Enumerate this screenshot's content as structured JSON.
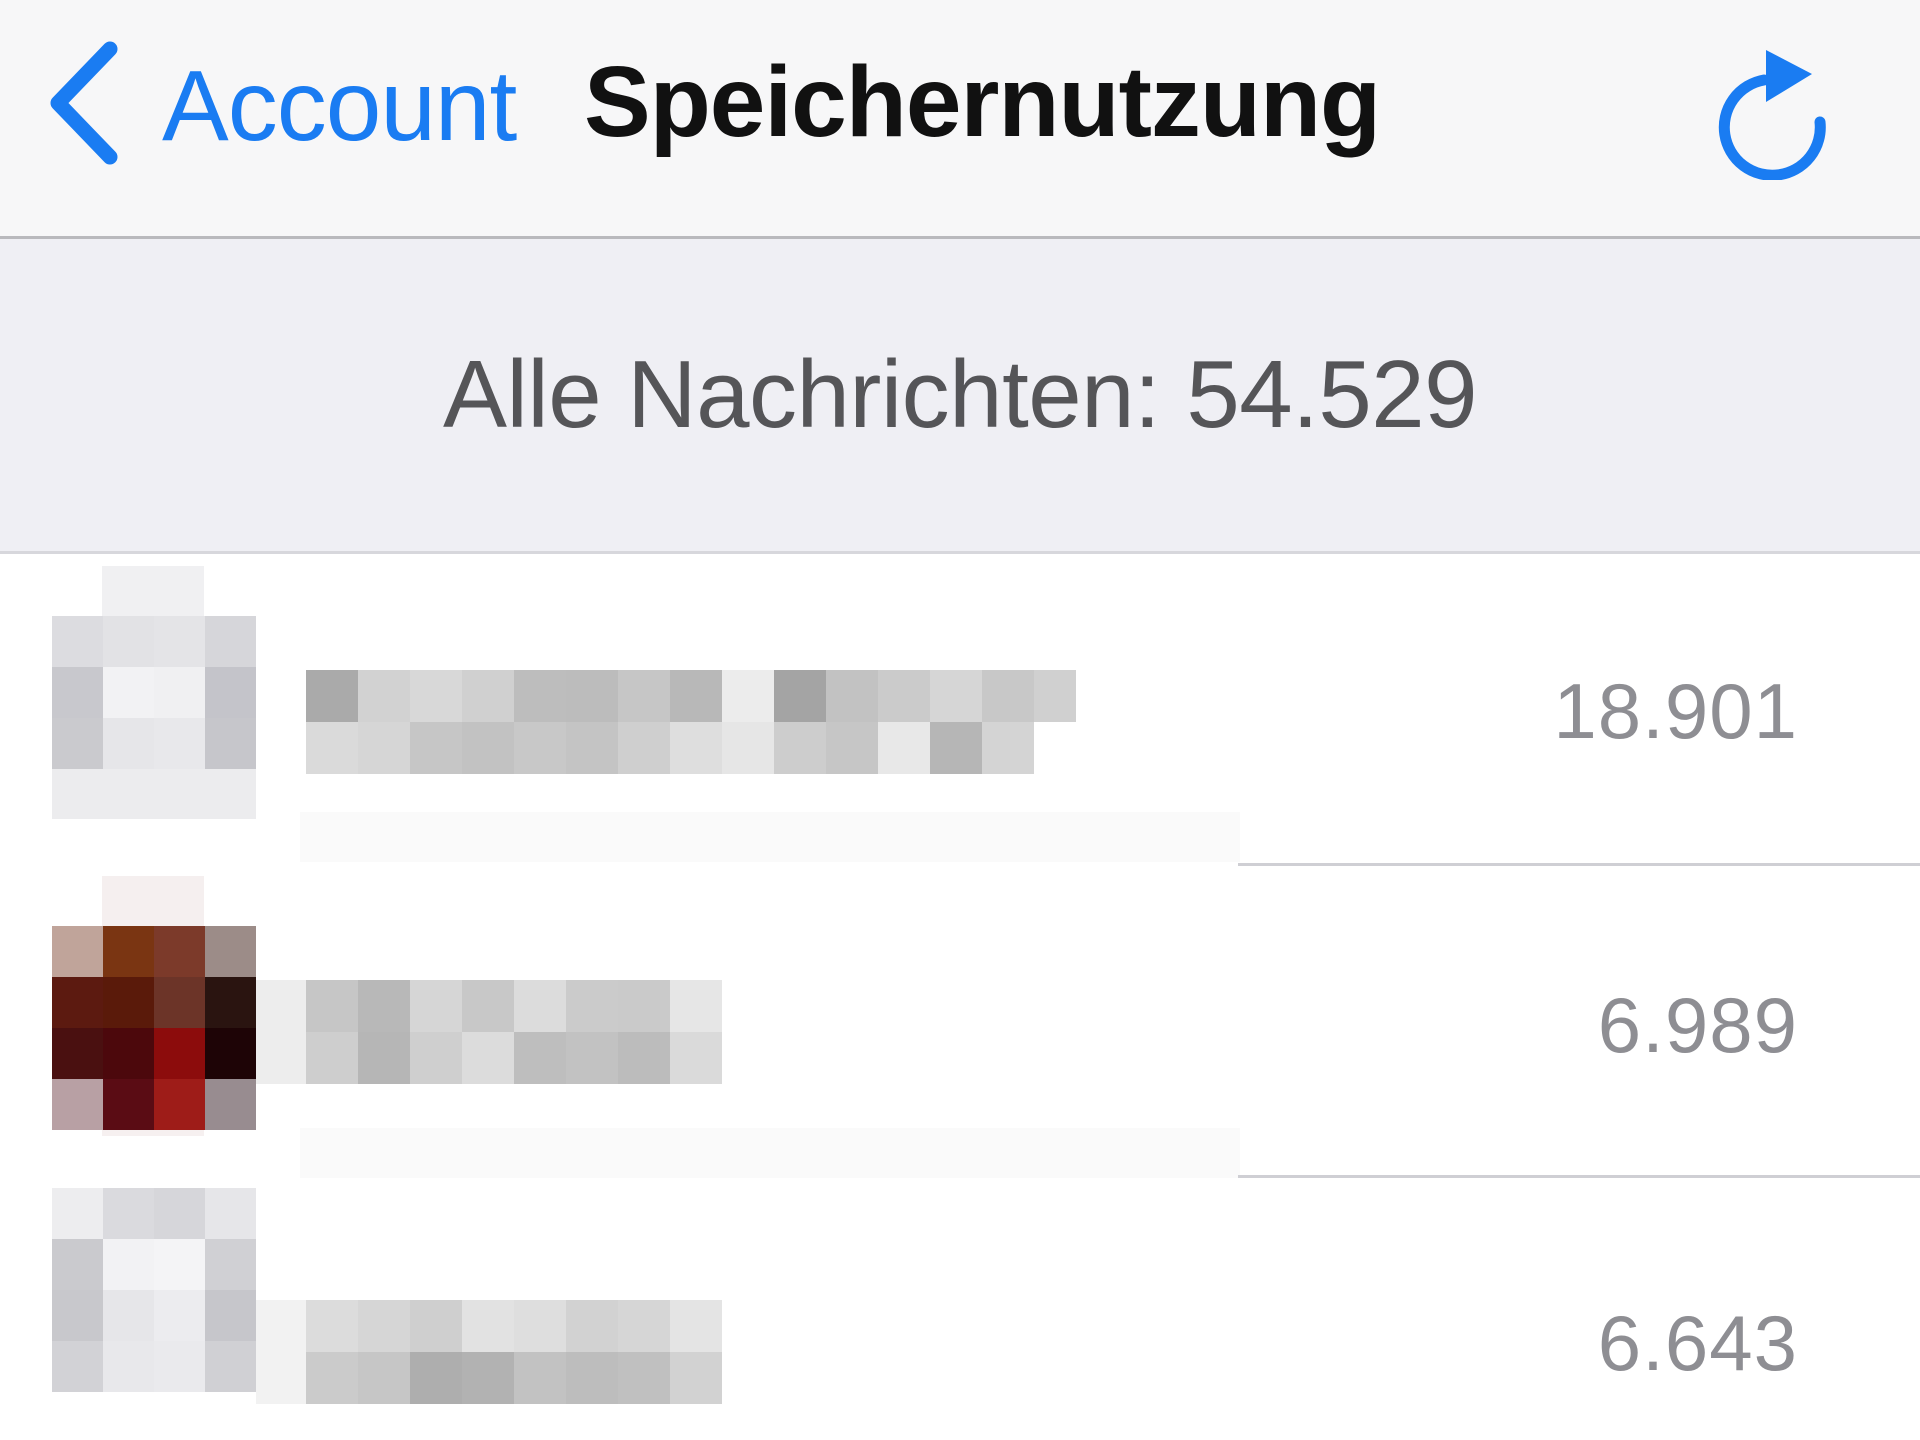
{
  "navbar": {
    "back_label": "Account",
    "back_icon": "chevron-left-icon",
    "title": "Speichernutzung",
    "refresh_icon": "refresh-icon",
    "accent_color": "#1a7cf2"
  },
  "summary": {
    "text": "Alle Nachrichten: 54.529"
  },
  "chats": [
    {
      "count": "18.901",
      "avatar_icon": "blurred-avatar"
    },
    {
      "count": "6.989",
      "avatar_icon": "blurred-avatar"
    },
    {
      "count": "6.643",
      "avatar_icon": "blurred-avatar"
    }
  ]
}
